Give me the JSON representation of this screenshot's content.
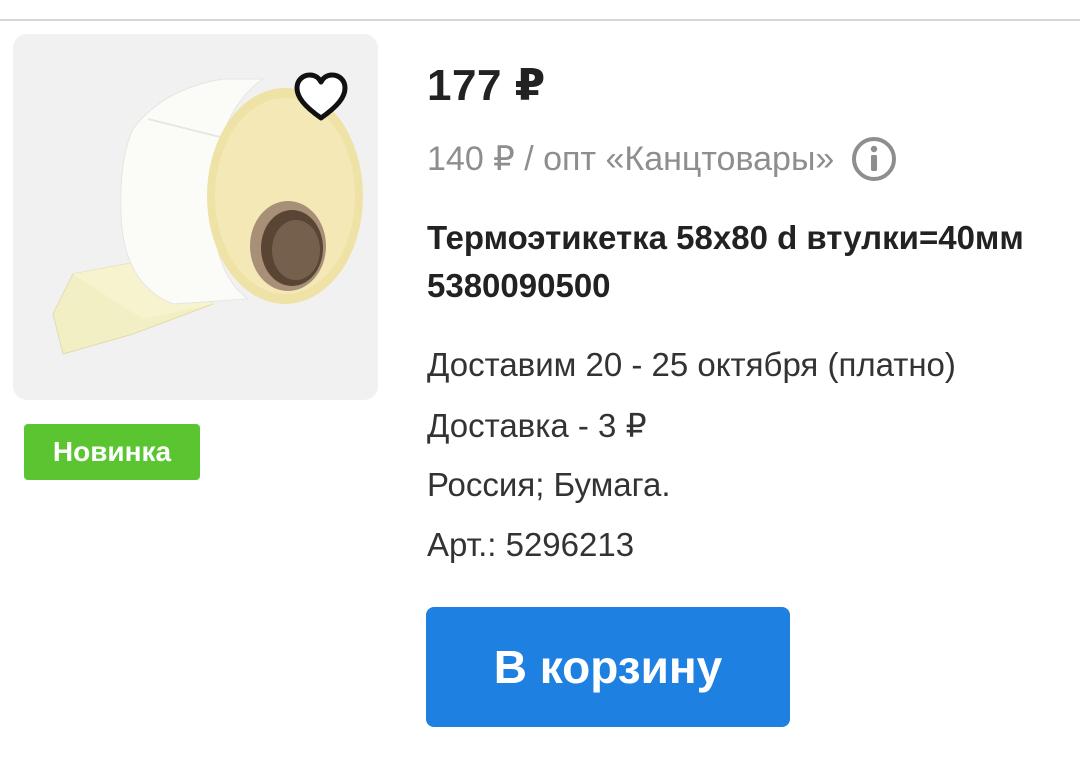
{
  "product": {
    "price": "177 ₽",
    "wholesale_text": "140 ₽ / опт «Канцтовары»",
    "title": "Термоэтикетка 58х80 d втулки=40мм 5380090500",
    "delivery_date": "Доставим 20 - 25 октября (платно)",
    "delivery_cost": "Доставка - 3 ₽",
    "origin_material": "Россия; Бумага.",
    "article": "Арт.: 5296213",
    "badge": "Новинка"
  },
  "actions": {
    "cart_button": "В корзину"
  },
  "icons": {
    "favorite": "heart-outline-icon",
    "info": "info-circle-icon"
  },
  "colors": {
    "badge": "#5ac531",
    "cart_button": "#1e80e0",
    "secondary_text": "#8e8e8e"
  }
}
